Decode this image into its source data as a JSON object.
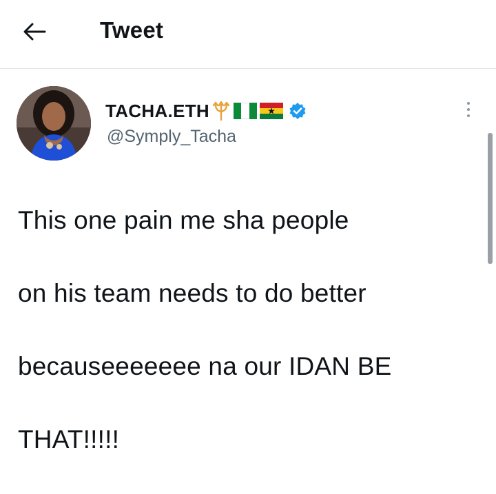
{
  "header": {
    "title": "Tweet",
    "back_icon": "arrow-left-icon"
  },
  "tweet": {
    "display_name": "TACHA.ETH",
    "name_emojis": [
      "trident-icon",
      "nigeria-flag-icon",
      "ghana-flag-icon"
    ],
    "verified": true,
    "handle": "@Symply_Tacha",
    "text_lines": [
      "This one pain me sha people",
      "on his team needs to do better",
      "becauseeeeeee na our IDAN BE",
      "THAT!!!!!"
    ]
  },
  "colors": {
    "text": "#0f1419",
    "secondary_text": "#536471",
    "verified_blue": "#1d9bf0",
    "divider": "#e3e6e8",
    "trident_gold": "#e8a33a"
  }
}
